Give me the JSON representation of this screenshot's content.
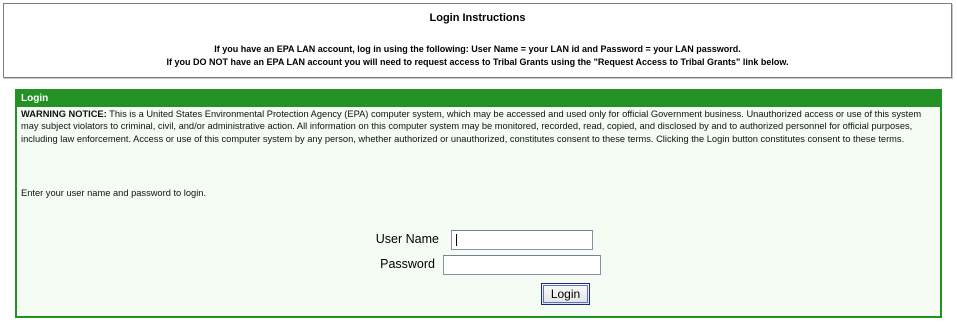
{
  "instructions": {
    "title": "Login Instructions",
    "line1": "If you have an EPA LAN account, log in using the following: User Name = your LAN id and Password = your LAN password.",
    "line2": "If you DO NOT have an EPA LAN account you will need to request access to Tribal Grants using the \"Request Access to Tribal Grants\" link below."
  },
  "login": {
    "header": "Login",
    "warning_label": "WARNING NOTICE:",
    "warning_text": " This is a United States Environmental Protection Agency (EPA) computer system, which may be accessed and used only for official Government business. Unauthorized access or use of this system may subject violators to criminal, civil, and/or administrative action. All information on this computer system may be monitored, recorded, read, copied, and disclosed by and to authorized personnel for official purposes, including law enforcement. Access or use of this computer system by any person, whether authorized or unauthorized, constitutes consent to these terms. Clicking the Login button constitutes consent to these terms.",
    "prompt": "Enter your user name and password to login.",
    "username_label": "User Name",
    "username_value": "",
    "password_label": "Password",
    "password_value": "",
    "button_label": "Login"
  },
  "colors": {
    "panel_green": "#239123",
    "panel_background": "#f4fcf4"
  }
}
